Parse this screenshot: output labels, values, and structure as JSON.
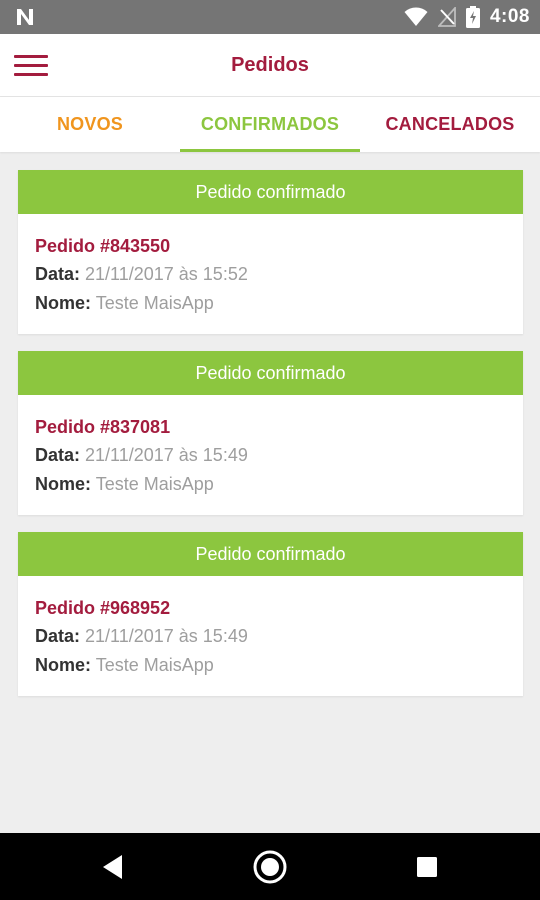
{
  "status_bar": {
    "time": "4:08",
    "notification_icon": "n-notification-icon",
    "icons": [
      "wifi-icon",
      "no-signal-icon",
      "battery-charging-icon"
    ]
  },
  "app_bar": {
    "title": "Pedidos",
    "menu_icon": "hamburger-menu-icon"
  },
  "tabs": [
    {
      "label": "NOVOS",
      "color": "#f0951e",
      "active": false
    },
    {
      "label": "CONFIRMADOS",
      "color": "#8cc63f",
      "active": true
    },
    {
      "label": "CANCELADOS",
      "color": "#a31c3e",
      "active": false
    }
  ],
  "orders": [
    {
      "header": "Pedido confirmado",
      "id_text": "Pedido #843550",
      "date_label": "Data:",
      "date_value": "21/11/2017 às 15:52",
      "name_label": "Nome:",
      "name_value": "Teste MaisApp"
    },
    {
      "header": "Pedido confirmado",
      "id_text": "Pedido #837081",
      "date_label": "Data:",
      "date_value": "21/11/2017 às 15:49",
      "name_label": "Nome:",
      "name_value": "Teste MaisApp"
    },
    {
      "header": "Pedido confirmado",
      "id_text": "Pedido #968952",
      "date_label": "Data:",
      "date_value": "21/11/2017 às 15:49",
      "name_label": "Nome:",
      "name_value": "Teste MaisApp"
    }
  ],
  "colors": {
    "brand": "#a31c3e",
    "confirmed_green": "#8cc63f",
    "new_orange": "#f0951e",
    "muted_text": "#9e9e9e"
  },
  "nav_bar": {
    "icons": [
      "back-icon",
      "home-icon",
      "recent-apps-icon"
    ]
  }
}
